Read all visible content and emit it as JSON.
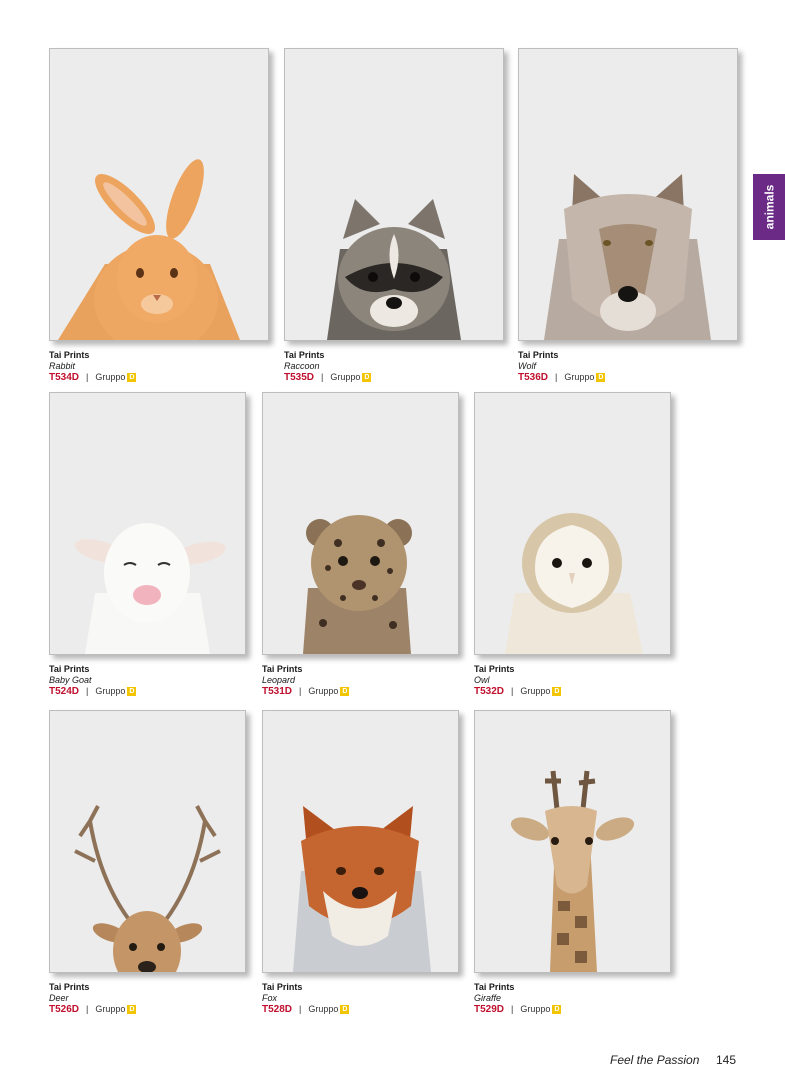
{
  "side_tab": {
    "label": "animals",
    "color": "#6a2a86"
  },
  "products": [
    {
      "brand": "Tai Prints",
      "name": "Rabbit",
      "code": "T534D",
      "group_label": "Gruppo",
      "group_letter": "D",
      "icon": "rabbit-illustration"
    },
    {
      "brand": "Tai Prints",
      "name": "Raccoon",
      "code": "T535D",
      "group_label": "Gruppo",
      "group_letter": "D",
      "icon": "raccoon-illustration"
    },
    {
      "brand": "Tai Prints",
      "name": "Wolf",
      "code": "T536D",
      "group_label": "Gruppo",
      "group_letter": "D",
      "icon": "wolf-illustration"
    },
    {
      "brand": "Tai Prints",
      "name": "Baby Goat",
      "code": "T524D",
      "group_label": "Gruppo",
      "group_letter": "D",
      "icon": "goat-illustration"
    },
    {
      "brand": "Tai Prints",
      "name": "Leopard",
      "code": "T531D",
      "group_label": "Gruppo",
      "group_letter": "D",
      "icon": "leopard-illustration"
    },
    {
      "brand": "Tai Prints",
      "name": "Owl",
      "code": "T532D",
      "group_label": "Gruppo",
      "group_letter": "D",
      "icon": "owl-illustration"
    },
    {
      "brand": "Tai Prints",
      "name": "Deer",
      "code": "T526D",
      "group_label": "Gruppo",
      "group_letter": "D",
      "icon": "deer-illustration"
    },
    {
      "brand": "Tai Prints",
      "name": "Fox",
      "code": "T528D",
      "group_label": "Gruppo",
      "group_letter": "D",
      "icon": "fox-illustration"
    },
    {
      "brand": "Tai Prints",
      "name": "Giraffe",
      "code": "T529D",
      "group_label": "Gruppo",
      "group_letter": "D",
      "icon": "giraffe-illustration"
    }
  ],
  "colors": {
    "code": "#c0102e",
    "badge": "#f2c500",
    "print_bg": "#ebebeb"
  },
  "footer": {
    "slogan": "Feel the Passion",
    "page_number": "145"
  }
}
